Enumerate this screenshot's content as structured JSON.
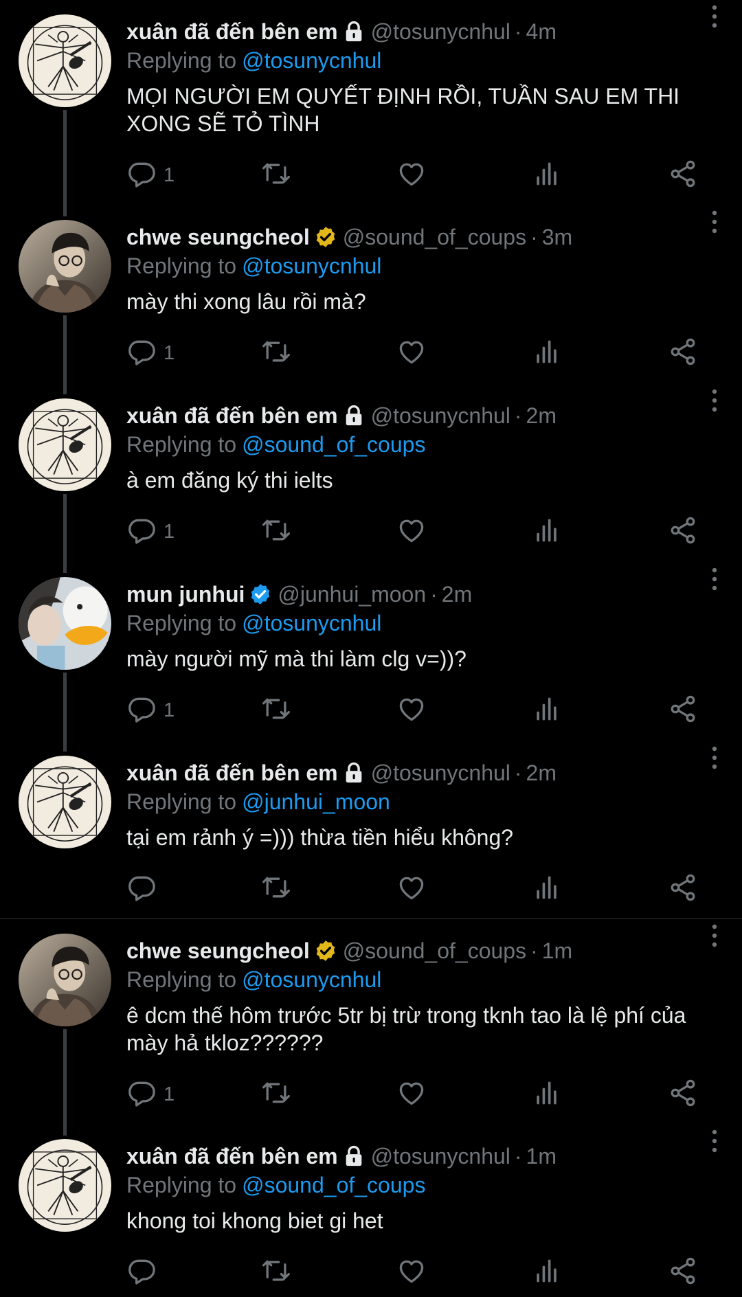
{
  "colors": {
    "background": "#000000",
    "text": "#e7e9ea",
    "muted": "#71767b",
    "link": "#1d9bf0",
    "verified_blue": "#1d9bf0",
    "verified_gold": "#e2b719"
  },
  "tweets": [
    {
      "name": "xuân đã đến bên em",
      "badge": "lock-icon",
      "handle": "@tosunycnhul",
      "time": "4m",
      "replying_label": "Replying to",
      "replying_to": "@tosunycnhul",
      "text": "MỌI NGƯỜI EM QUYẾT ĐỊNH RỒI, TUẦN SAU EM THI\nXONG SẼ TỎ TÌNH",
      "reply_count": "1",
      "avatar": "vitruvian-guitar-avatar"
    },
    {
      "name": "chwe seungcheol",
      "badge": "gold-verified-icon",
      "handle": "@sound_of_coups",
      "time": "3m",
      "replying_label": "Replying to",
      "replying_to": "@tosunycnhul",
      "text": "mày thi xong lâu rồi mà?",
      "reply_count": "1",
      "avatar": "photo-avatar-man-glasses"
    },
    {
      "name": "xuân đã đến bên em",
      "badge": "lock-icon",
      "handle": "@tosunycnhul",
      "time": "2m",
      "replying_label": "Replying to",
      "replying_to": "@sound_of_coups",
      "text": "à em đăng ký thi ielts",
      "reply_count": "1",
      "avatar": "vitruvian-guitar-avatar"
    },
    {
      "name": "mun junhui",
      "badge": "blue-verified-icon",
      "handle": "@junhui_moon",
      "time": "2m",
      "replying_label": "Replying to",
      "replying_to": "@tosunycnhul",
      "text": "mày người mỹ mà thi làm clg v=))?",
      "reply_count": "1",
      "avatar": "photo-avatar-duck"
    },
    {
      "name": "xuân đã đến bên em",
      "badge": "lock-icon",
      "handle": "@tosunycnhul",
      "time": "2m",
      "replying_label": "Replying to",
      "replying_to": "@junhui_moon",
      "text": "tại em rảnh ý =))) thừa tiền hiểu không?",
      "reply_count": "",
      "avatar": "vitruvian-guitar-avatar"
    },
    {
      "name": "chwe seungcheol",
      "badge": "gold-verified-icon",
      "handle": "@sound_of_coups",
      "time": "1m",
      "replying_label": "Replying to",
      "replying_to": "@tosunycnhul",
      "text": "ê dcm thế hôm trước 5tr bị trừ trong tknh tao là lệ phí của\nmày hả tkloz??????",
      "reply_count": "1",
      "avatar": "photo-avatar-man-glasses"
    },
    {
      "name": "xuân đã đến bên em",
      "badge": "lock-icon",
      "handle": "@tosunycnhul",
      "time": "1m",
      "replying_label": "Replying to",
      "replying_to": "@sound_of_coups",
      "text": "khong toi khong biet gi het",
      "reply_count": "",
      "avatar": "vitruvian-guitar-avatar"
    }
  ]
}
